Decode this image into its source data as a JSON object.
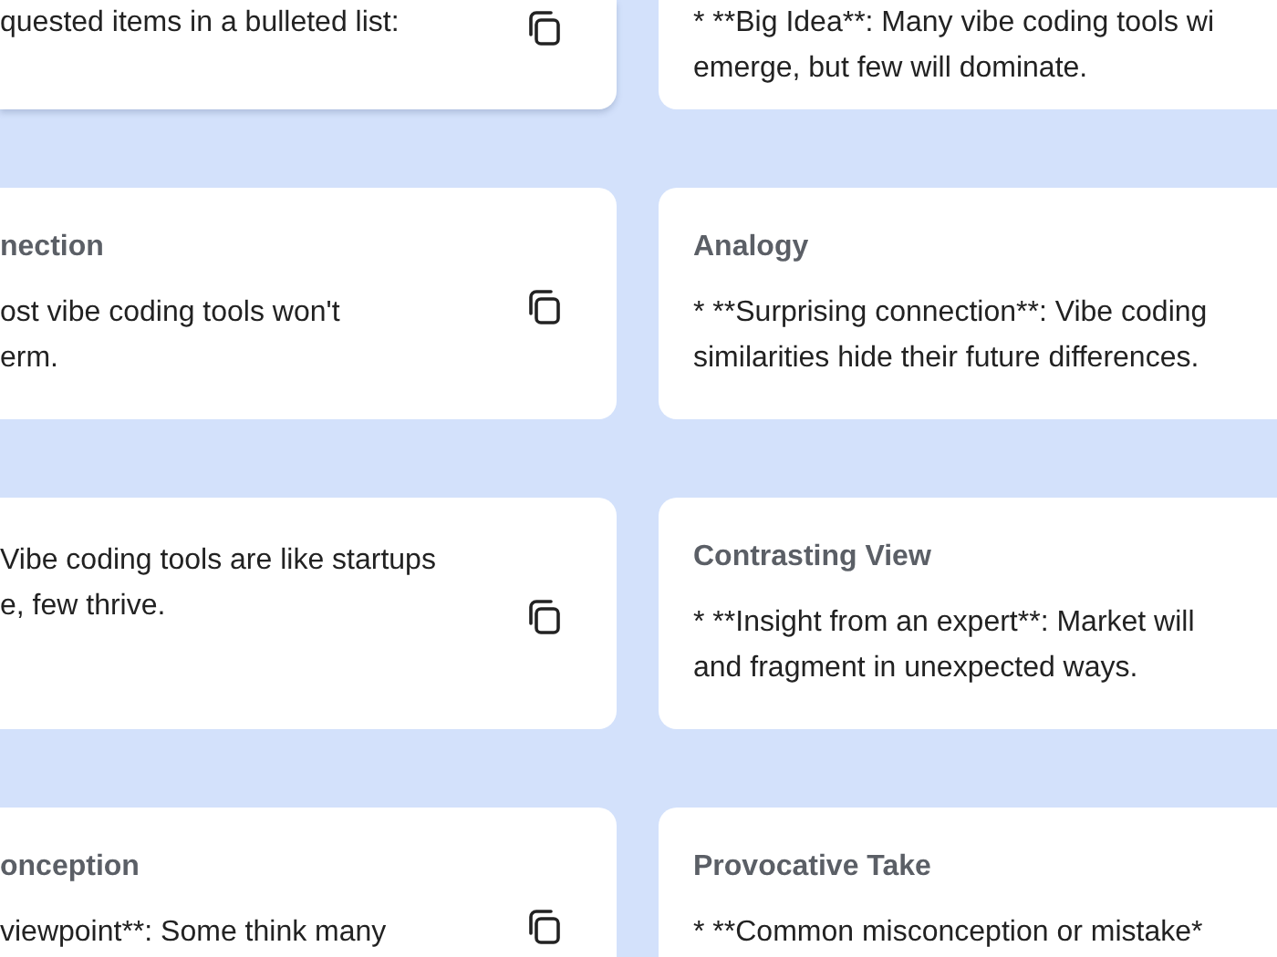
{
  "rows": [
    {
      "left": {
        "lines": [
          "quested items in a bulleted list:"
        ]
      },
      "right": {
        "lines": [
          "* **Big Idea**: Many vibe coding tools wi",
          "emerge, but few will dominate."
        ]
      }
    },
    {
      "left": {
        "title": "nection",
        "lines": [
          "ost vibe coding tools won't",
          "erm."
        ]
      },
      "right": {
        "title": "Analogy",
        "lines": [
          "* **Surprising connection**: Vibe coding",
          "similarities hide their future differences."
        ]
      }
    },
    {
      "left": {
        "lines": [
          "Vibe coding tools are like startups",
          "e, few thrive."
        ]
      },
      "right": {
        "title": "Contrasting View",
        "lines": [
          "* **Insight from an expert**: Market will",
          "and fragment in unexpected ways."
        ]
      }
    },
    {
      "left": {
        "title": "onception",
        "lines": [
          "viewpoint**: Some think many"
        ]
      },
      "right": {
        "title": "Provocative Take",
        "lines": [
          "* **Common misconception or mistake*"
        ]
      }
    }
  ]
}
